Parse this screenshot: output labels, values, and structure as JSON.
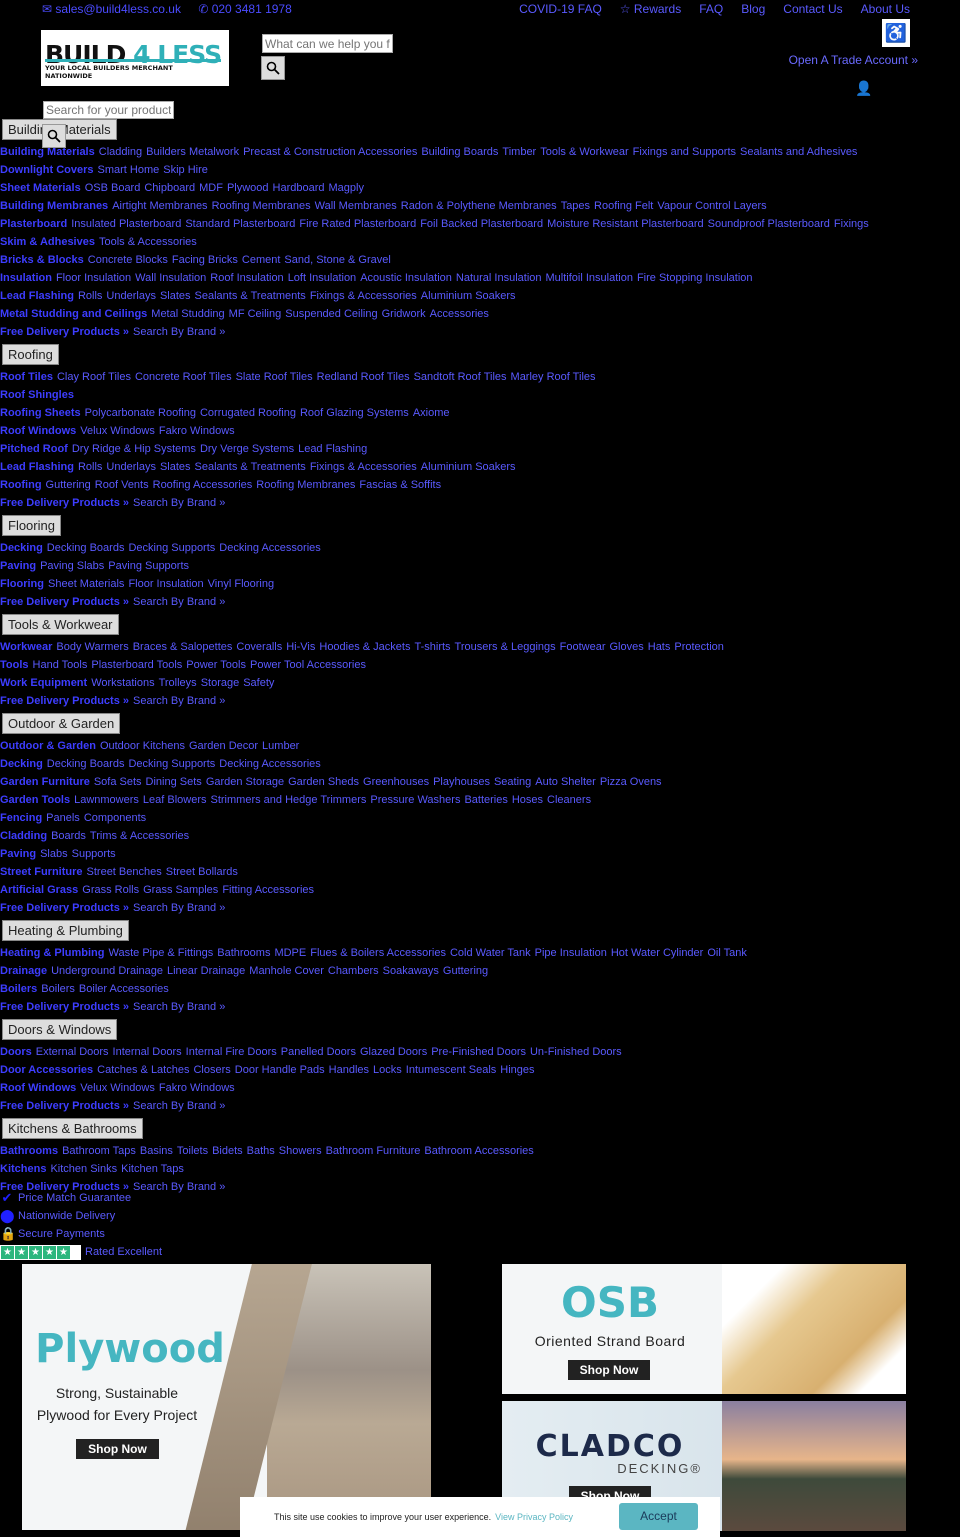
{
  "topbar": {
    "email": "✉ sales@build4less.co.uk",
    "phone": "✆ 020 3481 1978",
    "links": [
      "COVID-19 FAQ",
      "☆ Rewards",
      "FAQ",
      "Blog",
      "Contact Us",
      "About Us"
    ]
  },
  "logo": {
    "brand_left": "BUILD",
    "brand_mid": "4",
    "brand_right": "LESS",
    "tagline": "YOUR LOCAL BUILDERS MERCHANT NATIONWIDE"
  },
  "search": {
    "placeholder_main": "What can we help you find?",
    "placeholder_secondary": "Search for your product"
  },
  "account": {
    "trade_label": "Open A Trade Account »"
  },
  "menu": [
    {
      "category": "Building Materials",
      "rows": [
        [
          "Building Materials",
          "Cladding",
          "Builders Metalwork",
          "Precast & Construction Accessories",
          "Building Boards",
          "Timber",
          "Tools & Workwear",
          "Fixings and Supports",
          "Sealants and Adhesives"
        ],
        [
          "Downlight Covers",
          "Smart Home",
          "Skip Hire"
        ],
        [
          "Sheet Materials",
          "OSB Board",
          "Chipboard",
          "MDF",
          "Plywood",
          "Hardboard",
          "Magply"
        ],
        [
          "Building Membranes",
          "Airtight Membranes",
          "Roofing Membranes",
          "Wall Membranes",
          "Radon & Polythene Membranes",
          "Tapes",
          "Roofing Felt",
          "Vapour Control Layers"
        ],
        [
          "Plasterboard",
          "Insulated Plasterboard",
          "Standard Plasterboard",
          "Fire Rated Plasterboard",
          "Foil Backed Plasterboard",
          "Moisture Resistant Plasterboard",
          "Soundproof Plasterboard",
          "Fixings"
        ],
        [
          "Skim & Adhesives",
          "Tools & Accessories"
        ],
        [
          "Bricks & Blocks",
          "Concrete Blocks",
          "Facing Bricks",
          "Cement",
          "Sand, Stone & Gravel"
        ],
        [
          "Insulation",
          "Floor Insulation",
          "Wall Insulation",
          "Roof Insulation",
          "Loft Insulation",
          "Acoustic Insulation",
          "Natural Insulation",
          "Multifoil Insulation",
          "Fire Stopping Insulation"
        ],
        [
          "Lead Flashing",
          "Rolls",
          "Underlays",
          "Slates",
          "Sealants & Treatments",
          "Fixings & Accessories",
          "Aluminium Soakers"
        ],
        [
          "Metal Studding and Ceilings",
          "Metal Studding",
          "MF Ceiling",
          "Suspended Ceiling",
          "Gridwork",
          "Accessories"
        ],
        [
          "Free Delivery Products »",
          "Search By Brand »"
        ]
      ]
    },
    {
      "category": "Roofing",
      "rows": [
        [
          "Roof Tiles",
          "Clay Roof Tiles",
          "Concrete Roof Tiles",
          "Slate Roof Tiles",
          "Redland Roof Tiles",
          "Sandtoft Roof Tiles",
          "Marley Roof Tiles"
        ],
        [
          "Roof Shingles"
        ],
        [
          "Roofing Sheets",
          "Polycarbonate Roofing",
          "Corrugated Roofing",
          "Roof Glazing Systems",
          "Axiome"
        ],
        [
          "Roof Windows",
          "Velux Windows",
          "Fakro Windows"
        ],
        [
          "Pitched Roof",
          "Dry Ridge & Hip Systems",
          "Dry Verge Systems",
          "Lead Flashing"
        ],
        [
          "Lead Flashing",
          "Rolls",
          "Underlays",
          "Slates",
          "Sealants & Treatments",
          "Fixings & Accessories",
          "Aluminium Soakers"
        ],
        [
          "Roofing",
          "Guttering",
          "Roof Vents",
          "Roofing Accessories",
          "Roofing Membranes",
          "Fascias & Soffits"
        ],
        [
          "Free Delivery Products »",
          "Search By Brand »"
        ]
      ]
    },
    {
      "category": "Flooring",
      "rows": [
        [
          "Decking",
          "Decking Boards",
          "Decking Supports",
          "Decking Accessories"
        ],
        [
          "Paving",
          "Paving Slabs",
          "Paving Supports"
        ],
        [
          "Flooring",
          "Sheet Materials",
          "Floor Insulation",
          "Vinyl Flooring"
        ],
        [
          "Free Delivery Products »",
          "Search By Brand »"
        ]
      ]
    },
    {
      "category": "Tools & Workwear",
      "rows": [
        [
          "Workwear",
          "Body Warmers",
          "Braces & Salopettes",
          "Coveralls",
          "Hi-Vis",
          "Hoodies & Jackets",
          "T-shirts",
          "Trousers & Leggings",
          "Footwear",
          "Gloves",
          "Hats",
          "Protection"
        ],
        [
          "Tools",
          "Hand Tools",
          "Plasterboard Tools",
          "Power Tools",
          "Power Tool Accessories"
        ],
        [
          "Work Equipment",
          "Workstations",
          "Trolleys",
          "Storage",
          "Safety"
        ],
        [
          "Free Delivery Products »",
          "Search By Brand »"
        ]
      ]
    },
    {
      "category": "Outdoor & Garden",
      "rows": [
        [
          "Outdoor & Garden",
          "Outdoor Kitchens",
          "Garden Decor",
          "Lumber"
        ],
        [
          "Decking",
          "Decking Boards",
          "Decking Supports",
          "Decking Accessories"
        ],
        [
          "Garden Furniture",
          "Sofa Sets",
          "Dining Sets",
          "Garden Storage",
          "Garden Sheds",
          "Greenhouses",
          "Playhouses",
          "Seating",
          "Auto Shelter",
          "Pizza Ovens"
        ],
        [
          "Garden Tools",
          "Lawnmowers",
          "Leaf Blowers",
          "Strimmers and Hedge Trimmers",
          "Pressure Washers",
          "Batteries",
          "Hoses",
          "Cleaners"
        ],
        [
          "Fencing",
          "Panels",
          "Components"
        ],
        [
          "Cladding",
          "Boards",
          "Trims & Accessories"
        ],
        [
          "Paving",
          "Slabs",
          "Supports"
        ],
        [
          "Street Furniture",
          "Street Benches",
          "Street Bollards"
        ],
        [
          "Artificial Grass",
          "Grass Rolls",
          "Grass Samples",
          "Fitting Accessories"
        ],
        [
          "Free Delivery Products »",
          "Search By Brand »"
        ]
      ]
    },
    {
      "category": "Heating & Plumbing",
      "rows": [
        [
          "Heating & Plumbing",
          "Waste Pipe & Fittings",
          "Bathrooms",
          "MDPE",
          "Flues & Boilers Accessories",
          "Cold Water Tank",
          "Pipe Insulation",
          "Hot Water Cylinder",
          "Oil Tank"
        ],
        [
          "Drainage",
          "Underground Drainage",
          "Linear Drainage",
          "Manhole Cover",
          "Chambers",
          "Soakaways",
          "Guttering"
        ],
        [
          "Boilers",
          "Boilers",
          "Boiler Accessories"
        ],
        [
          "Free Delivery Products »",
          "Search By Brand »"
        ]
      ]
    },
    {
      "category": "Doors & Windows",
      "rows": [
        [
          "Doors",
          "External Doors",
          "Internal Doors",
          "Internal Fire Doors",
          "Panelled Doors",
          "Glazed Doors",
          "Pre-Finished Doors",
          "Un-Finished Doors"
        ],
        [
          "Door Accessories",
          "Catches & Latches",
          "Closers",
          "Door Handle Pads",
          "Handles",
          "Locks",
          "Intumescent Seals",
          "Hinges"
        ],
        [
          "Roof Windows",
          "Velux Windows",
          "Fakro Windows"
        ],
        [
          "Free Delivery Products »",
          "Search By Brand »"
        ]
      ]
    },
    {
      "category": "Kitchens & Bathrooms",
      "rows": [
        [
          "Bathrooms",
          "Bathroom Taps",
          "Basins",
          "Toilets",
          "Bidets",
          "Baths",
          "Showers",
          "Bathroom Furniture",
          "Bathroom Accessories"
        ],
        [
          "Kitchens",
          "Kitchen Sinks",
          "Kitchen Taps"
        ],
        [
          "Free Delivery Products »",
          "Search By Brand »"
        ]
      ]
    }
  ],
  "usps": {
    "price_match": "Price Match Guarantee",
    "delivery": "Nationwide Delivery",
    "payments": "Secure Payments",
    "rating": "Rated Excellent",
    "stars": 4.5
  },
  "banners": {
    "plywood": {
      "title": "Plywood",
      "line1": "Strong, Sustainable",
      "line2": "Plywood for Every Project",
      "cta": "Shop Now"
    },
    "osb": {
      "title": "OSB",
      "subtitle": "Oriented Strand Board",
      "cta": "Shop Now"
    },
    "cladco": {
      "title": "CLADCO",
      "subtitle": "DECKING®",
      "cta": "Shop Now"
    }
  },
  "cookie": {
    "text": "This site use cookies to improve your user experience.",
    "link": "View Privacy Policy",
    "accept": "Accept"
  },
  "colors": {
    "link": "#5a5aff",
    "teal": "#45b6c1",
    "trustpilot": "#2cb67d"
  }
}
